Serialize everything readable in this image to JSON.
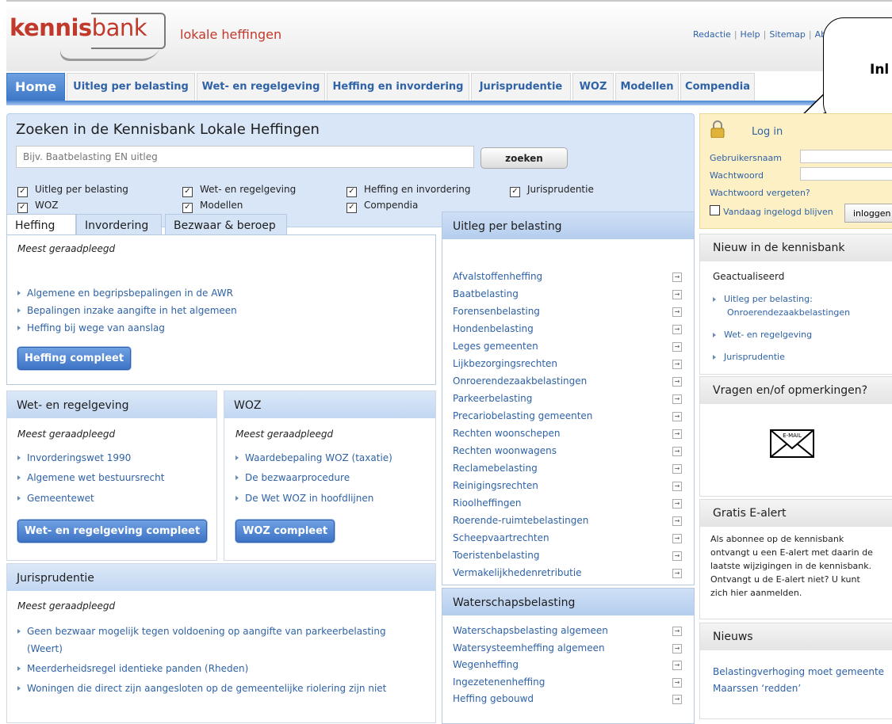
{
  "header": {
    "logo_text_bold": "kennis",
    "logo_text_light": "bank",
    "subtitle": "lokale heffingen",
    "links": [
      "Redactie",
      "Help",
      "Sitemap",
      "Ab"
    ]
  },
  "callout": {
    "text": "Inl"
  },
  "tabs": [
    "Home",
    "Uitleg per belasting",
    "Wet- en regelgeving",
    "Heffing en invordering",
    "Jurisprudentie",
    "WOZ",
    "Modellen",
    "Compendia"
  ],
  "search": {
    "title": "Zoeken in de Kennisbank Lokale Heffingen",
    "placeholder": "Bijv. Baatbelasting EN uitleg",
    "button": "zoeken",
    "filters": [
      "Uitleg per belasting",
      "Wet- en regelgeving",
      "Heffing en invordering",
      "Jurisprudentie",
      "WOZ",
      "Modellen",
      "Compendia"
    ]
  },
  "login": {
    "title": "Log in",
    "username_label": "Gebruikersnaam",
    "password_label": "Wachtwoord",
    "forgot": "Wachtwoord vergeten?",
    "remember": "Vandaag ingelogd blijven",
    "button": "inloggen"
  },
  "heffing": {
    "tabs": [
      "Heffing",
      "Invordering",
      "Bezwaar & beroep"
    ],
    "most_viewed": "Meest geraadpleegd",
    "items": [
      "Algemene en begripsbepalingen in de AWR",
      "Bepalingen inzake aangifte in het algemeen",
      "Heffing bij wege van aanslag"
    ],
    "button": "Heffing compleet"
  },
  "wet": {
    "title": "Wet- en regelgeving",
    "most_viewed": "Meest geraadpleegd",
    "items": [
      "Invorderingswet 1990",
      "Algemene wet bestuursrecht",
      "Gemeentewet"
    ],
    "button": "Wet- en regelgeving compleet"
  },
  "woz": {
    "title": "WOZ",
    "most_viewed": "Meest geraadpleegd",
    "items": [
      "Waardebepaling WOZ (taxatie)",
      "De bezwaarprocedure",
      "De Wet WOZ in hoofdlijnen"
    ],
    "button": "WOZ compleet"
  },
  "juris": {
    "title": "Jurisprudentie",
    "most_viewed": "Meest geraadpleegd",
    "items": [
      "Geen bezwaar mogelijk tegen voldoening op aangifte van parkeerbelasting",
      "(Weert)",
      "Meerderheidsregel identieke panden (Rheden)",
      "Woningen die direct zijn aangesloten op de gemeentelijke riolering zijn niet"
    ]
  },
  "uitleg": {
    "title": "Uitleg per belasting",
    "items": [
      "Afvalstoffenheffing",
      "Baatbelasting",
      "Forensenbelasting",
      "Hondenbelasting",
      "Leges gemeenten",
      "Lijkbezorgingsrechten",
      "Onroerendezaakbelastingen",
      "Parkeerbelasting",
      "Precariobelasting gemeenten",
      "Rechten woonschepen",
      "Rechten woonwagens",
      "Reclamebelasting",
      "Reinigingsrechten",
      "Rioolheffingen",
      "Roerende-ruimtebelastingen",
      "Scheepvaartrechten",
      "Toeristenbelasting",
      "Vermakelijkhedenretributie"
    ]
  },
  "waterschap": {
    "title": "Waterschapsbelasting",
    "items": [
      "Waterschapsbelasting algemeen",
      "Watersysteemheffing algemeen",
      "Wegenheffing",
      "Ingezetenenheffing",
      "Heffing gebouwd"
    ]
  },
  "nieuw": {
    "title": "Nieuw in de kennisbank",
    "subtitle": "Geactualiseerd",
    "items": [
      "Uitleg per belasting:",
      "Onroerendezaakbelastingen",
      "Wet- en regelgeving",
      "Jurisprudentie"
    ]
  },
  "vragen": {
    "title": "Vragen en/of opmerkingen?",
    "email_label": "E-MAIL"
  },
  "ealert": {
    "title": "Gratis E-alert",
    "lines": [
      "Als abonnee op de kennisbank",
      "ontvangt u een E-alert met daarin de",
      "laatste wijzigingen in de kennisbank.",
      "Ontvangt u de E-alert niet? U kunt",
      "zich hier aanmelden."
    ]
  },
  "nieuws": {
    "title": "Nieuws",
    "items": [
      "Belastingverhoging moet gemeente",
      "Maarssen ‘redden’"
    ]
  },
  "colors": {
    "brand_red": "#c0392b",
    "link_blue": "#2f62a6",
    "tab_blue": "#3c77c7"
  },
  "icons": [
    "lock-icon",
    "email-envelope-icon",
    "arrow-right-icon",
    "bullet-triangle-icon",
    "checkbox-checked-icon"
  ]
}
